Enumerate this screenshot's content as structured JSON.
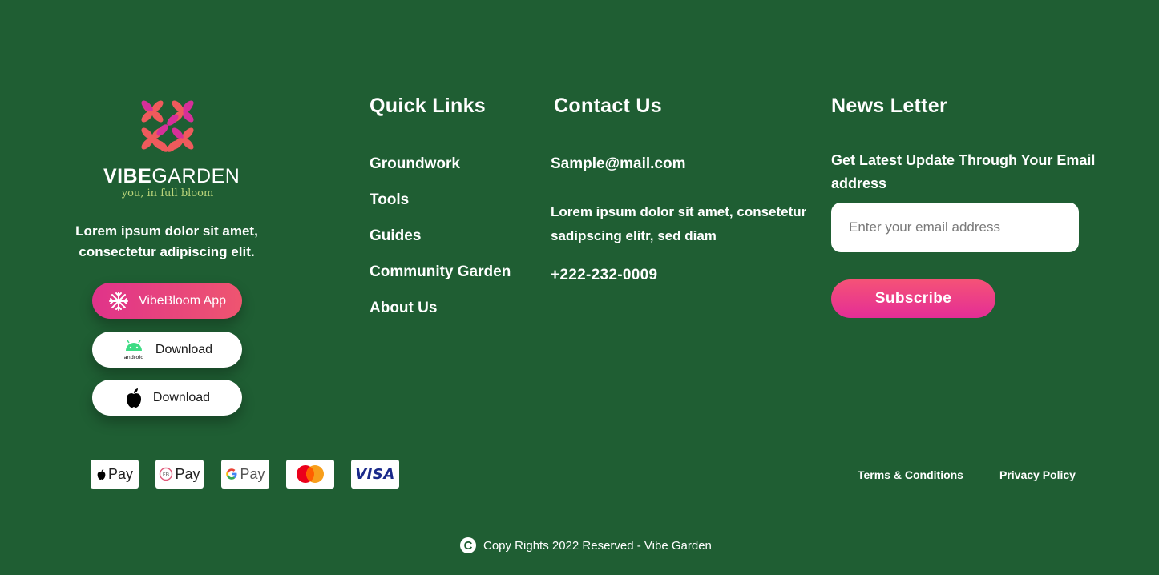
{
  "brand": {
    "name_bold": "VIBE",
    "name_regular": "GARDEN",
    "tagline": "you, in full bloom",
    "description": "Lorem ipsum dolor sit amet, consectetur adipiscing elit."
  },
  "apps": {
    "primary_label": "VibeBloom App",
    "android_label": "Download",
    "ios_label": "Download"
  },
  "quick_links": {
    "title": "Quick Links",
    "items": [
      "Groundwork",
      "Tools",
      "Guides",
      "Community Garden",
      "About Us"
    ]
  },
  "contact": {
    "title": "Contact Us",
    "email": "Sample@mail.com",
    "address": "Lorem ipsum dolor sit amet, consetetur sadipscing elitr, sed diam",
    "phone": "+222-232-0009"
  },
  "newsletter": {
    "title": "News Letter",
    "description": "Get Latest Update Through Your Email address",
    "placeholder": "Enter your email address",
    "subscribe_label": "Subscribe"
  },
  "payments": [
    {
      "name": "apple-pay",
      "text": "Pay"
    },
    {
      "name": "fb-pay",
      "text": "Pay"
    },
    {
      "name": "google-pay",
      "text": "Pay"
    },
    {
      "name": "mastercard",
      "text": ""
    },
    {
      "name": "visa",
      "text": "VISA"
    }
  ],
  "legal": {
    "terms": "Terms & Conditions",
    "privacy": "Privacy Policy"
  },
  "copyright": {
    "symbol": "C",
    "text": "Copy Rights 2022 Reserved - Vibe Garden"
  },
  "colors": {
    "background": "#1f5e33",
    "accent_pink": "#e42d96",
    "accent_coral": "#f55277",
    "tagline_green": "#b9d47a"
  }
}
